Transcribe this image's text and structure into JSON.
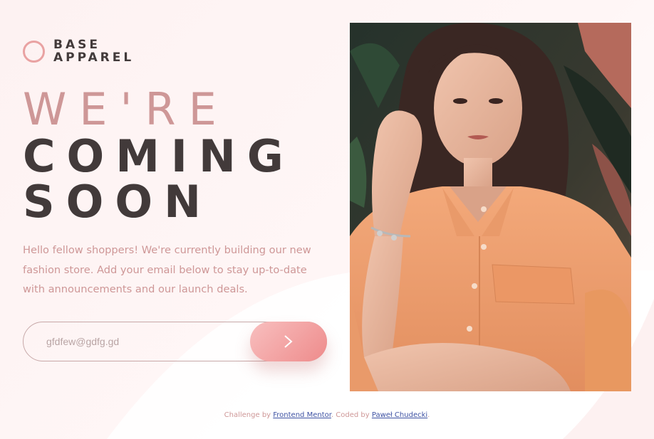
{
  "logo": {
    "line1": "BASE",
    "line2": "APPAREL"
  },
  "headline": {
    "line1": "WE'RE",
    "line2": "COMING",
    "line3": "SOON"
  },
  "intro": "Hello fellow shoppers! We're currently building our new fashion store. Add your email below to stay up-to-date with announcements and our launch deals.",
  "form": {
    "email_value": "gfdfew@gdfg.gd",
    "submit_icon": "chevron-right-icon"
  },
  "hero": {
    "image": "photo-of-woman-in-orange-shirt"
  },
  "footer": {
    "prefix": "Challenge by ",
    "link1": "Frontend Mentor",
    "middle": ". Coded by ",
    "link2": "Paweł Chudecki",
    "suffix": "."
  },
  "colors": {
    "accent": "#ce9797",
    "dark": "#423a3a",
    "button_start": "#f8bfbf",
    "button_end": "#ee8b8b"
  }
}
